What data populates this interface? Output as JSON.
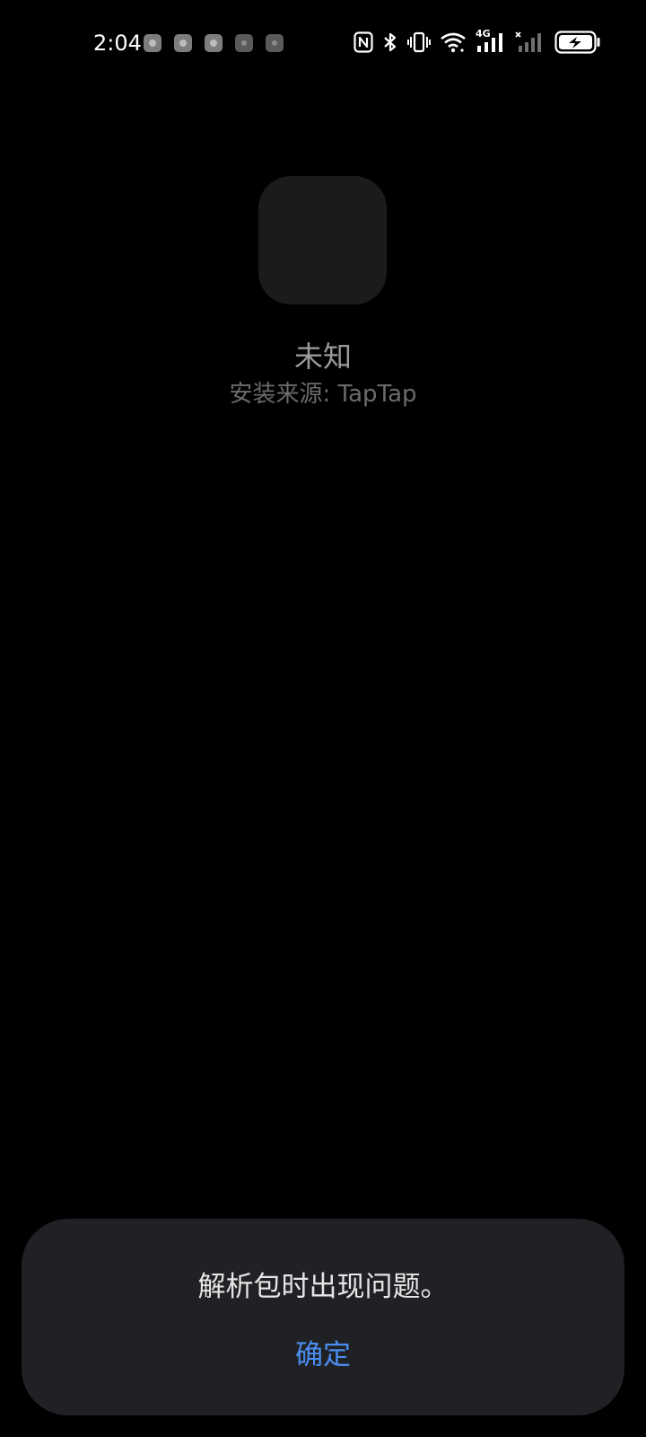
{
  "status_bar": {
    "time": "2:04",
    "network_type": "4G",
    "colors": {
      "foreground": "#ffffff",
      "notif_icon": "#7d7d7d"
    },
    "icons": [
      "nfc-icon",
      "bluetooth-icon",
      "vibrate-icon",
      "wifi-icon",
      "signal-4g-icon",
      "signal-no-sim-icon",
      "battery-charging-icon"
    ]
  },
  "app": {
    "name": "未知",
    "install_source": "安装来源: TapTap"
  },
  "dialog": {
    "message": "解析包时出现问题。",
    "confirm_label": "确定",
    "colors": {
      "background": "#202124",
      "accent": "#4a8df0"
    }
  }
}
